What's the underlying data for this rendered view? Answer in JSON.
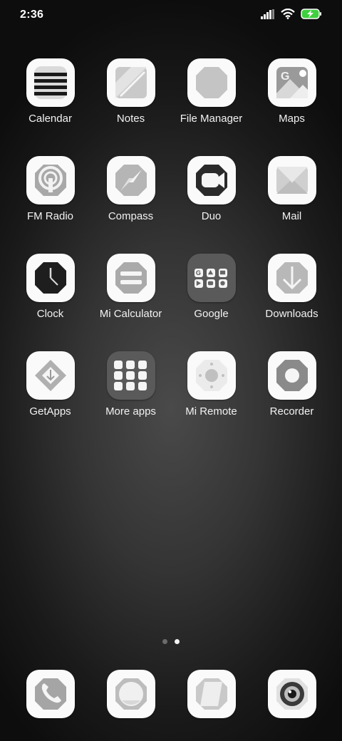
{
  "status_bar": {
    "time": "2:36"
  },
  "apps": [
    {
      "label": "Calendar"
    },
    {
      "label": "Notes"
    },
    {
      "label": "File Manager"
    },
    {
      "label": "Maps"
    },
    {
      "label": "FM Radio"
    },
    {
      "label": "Compass"
    },
    {
      "label": "Duo"
    },
    {
      "label": "Mail"
    },
    {
      "label": "Clock"
    },
    {
      "label": "Mi Calculator"
    },
    {
      "label": "Google"
    },
    {
      "label": "Downloads"
    },
    {
      "label": "GetApps"
    },
    {
      "label": "More apps"
    },
    {
      "label": "Mi Remote"
    },
    {
      "label": "Recorder"
    }
  ],
  "page_indicator": {
    "pages": 2,
    "current": 2
  },
  "dock": [
    {
      "icon": "phone-icon"
    },
    {
      "icon": "messaging-icon"
    },
    {
      "icon": "browser-icon"
    },
    {
      "icon": "camera-icon"
    }
  ]
}
